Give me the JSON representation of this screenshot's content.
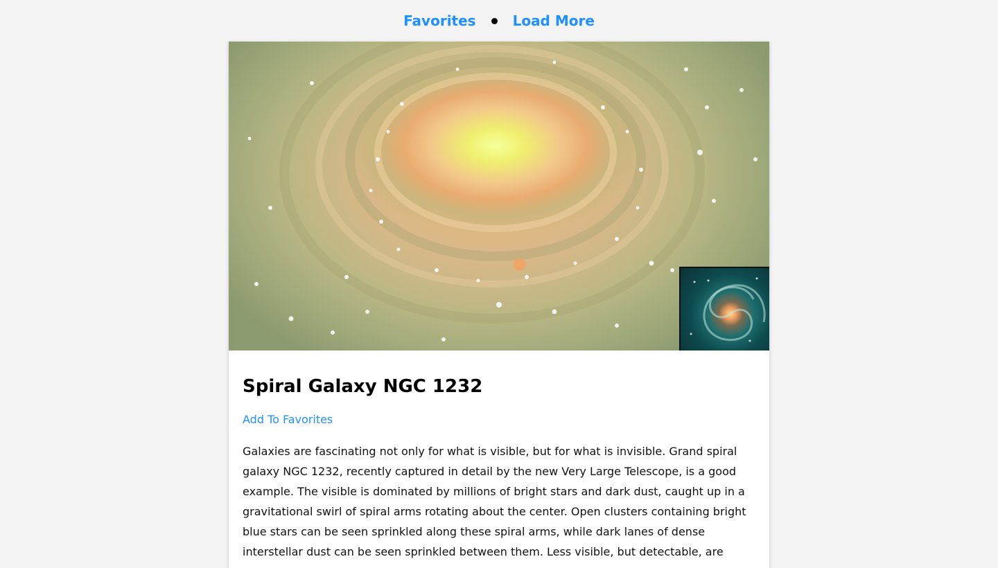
{
  "nav": {
    "favorites_label": "Favorites",
    "load_more_label": "Load More"
  },
  "post": {
    "title": "Spiral Galaxy NGC 1232",
    "add_favorites_label": "Add To Favorites",
    "description": "Galaxies are fascinating not only for what is visible, but for what is invisible. Grand spiral galaxy NGC 1232, recently captured in detail by the new Very Large Telescope, is a good example. The visible is dominated by millions of bright stars and dark dust, caught up in a gravitational swirl of spiral arms rotating about the center. Open clusters containing bright blue stars can be seen sprinkled along these spiral arms, while dark lanes of dense interstellar dust can be seen sprinkled between them. Less visible, but detectable, are"
  },
  "colors": {
    "link": "#1e90ff",
    "page_bg": "#f4f4f4",
    "card_bg": "#ffffff"
  }
}
